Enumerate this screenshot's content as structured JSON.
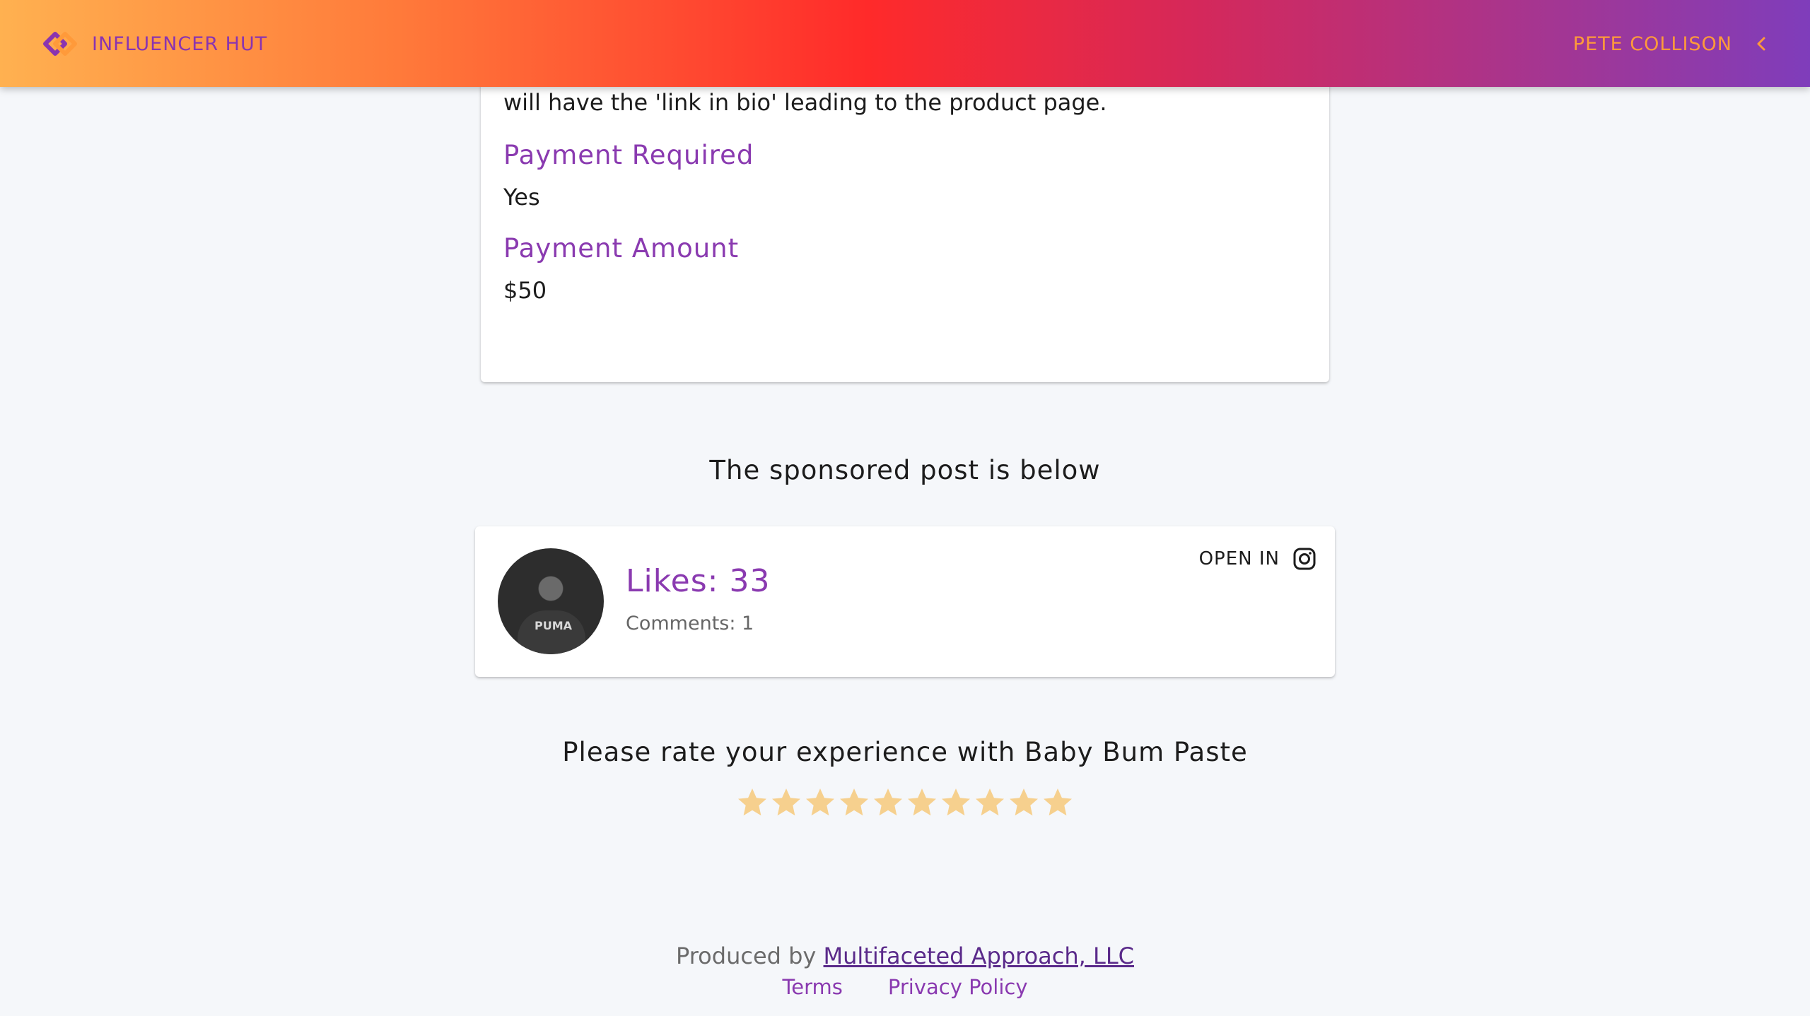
{
  "header": {
    "brand_name": "INFLUENCER HUT",
    "user_name": "PETE COLLISON"
  },
  "campaign": {
    "description_tail": "will have the 'link in bio' leading to the product page.",
    "payment_required_label": "Payment Required",
    "payment_required_value": "Yes",
    "payment_amount_label": "Payment Amount",
    "payment_amount_value": "$50"
  },
  "post": {
    "section_title": "The sponsored post is below",
    "likes": "Likes: 33",
    "comments": "Comments: 1",
    "open_in_label": "OPEN IN",
    "open_in_icon": "instagram-icon",
    "avatar_shirt_text": "PUMA"
  },
  "rating": {
    "title": "Please rate your experience with Baby Bum Paste",
    "max_stars": 10,
    "selected": 0,
    "star_color": "#f6d08e"
  },
  "footer": {
    "produced_by": "Produced by",
    "company": "Multifaceted Approach, LLC",
    "terms": "Terms",
    "privacy": "Privacy Policy"
  },
  "colors": {
    "accent_purple": "#8a3ab0",
    "header_gradient_start": "#ffb150",
    "header_gradient_mid": "#ff2a2a",
    "header_gradient_end": "#7f3dbb",
    "user_name_color": "#ff9a3a"
  }
}
